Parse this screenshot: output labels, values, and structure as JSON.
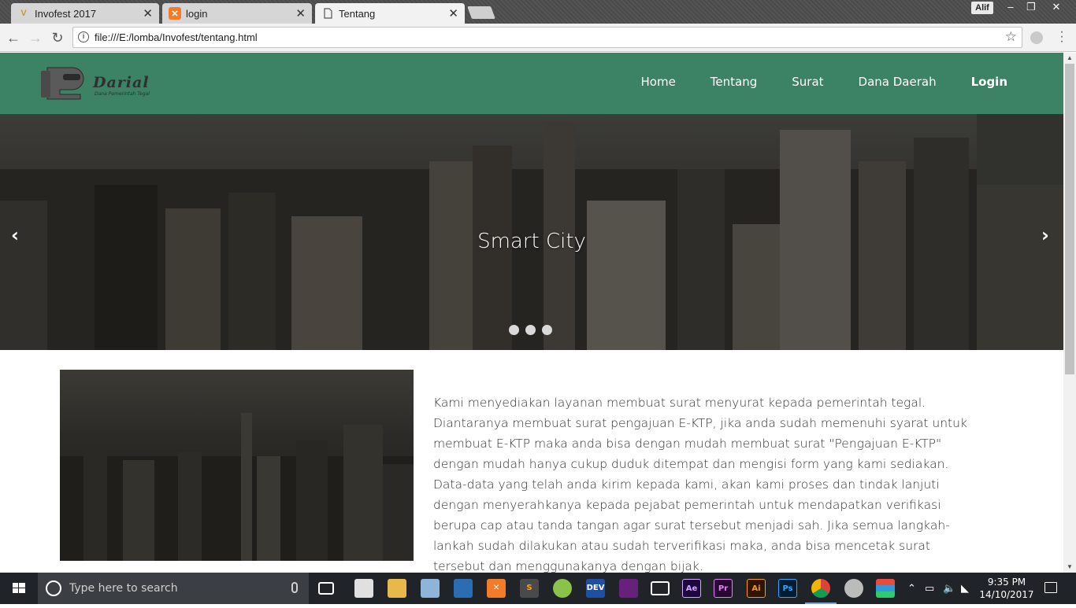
{
  "browser": {
    "tabs": [
      {
        "title": "Invofest 2017",
        "favicon": "v-logo-icon",
        "active": false
      },
      {
        "title": "login",
        "favicon": "xampp-icon",
        "active": false
      },
      {
        "title": "Tentang",
        "favicon": "page-icon",
        "active": true
      }
    ],
    "profile_name": "Alif",
    "url": "file:///E:/lomba/Invofest/tentang.html"
  },
  "site": {
    "logo_text": "Darial",
    "logo_tagline": "Dana Pemerintah Tegal",
    "nav": [
      "Home",
      "Tentang",
      "Surat",
      "Dana Daerah",
      "Login"
    ],
    "nav_bold": "Login",
    "hero_title": "Smart City",
    "prev_glyph": "‹",
    "next_glyph": "›",
    "carousel_count": 3,
    "paragraph": "Kami menyediakan layanan membuat surat menyurat kepada pemerintah tegal. Diantaranya membuat surat pengajuan E-KTP, jika anda sudah memenuhi syarat untuk membuat E-KTP maka anda bisa dengan mudah membuat surat \"Pengajuan E-KTP\" dengan mudah hanya cukup duduk ditempat dan mengisi form yang kami sediakan. Data-data yang telah anda kirim kepada kami, akan kami proses dan tindak lanjuti dengan menyerahkanya kepada pejabat pemerintah untuk mendapatkan verifikasi berupa cap atau tanda tangan agar surat tersebut menjadi sah. Jika semua langkah-lankah sudah dilakukan atau sudah terverifikasi maka, anda bisa mencetak surat tersebut dan menggunakanya dengan bijak.",
    "colors": {
      "nav_bg": "#3c8264",
      "text": "#333333"
    }
  },
  "taskbar": {
    "search_placeholder": "Type here to search",
    "time": "9:35 PM",
    "date": "14/10/2017",
    "apps": [
      "task-view-icon",
      "store-icon",
      "file-explorer-icon",
      "box-icon",
      "visual-studio-code-icon",
      "xampp-icon",
      "sublime-text-icon",
      "android-studio-icon",
      "dev-cpp-icon",
      "visual-studio-icon",
      "film-icon",
      "after-effects-icon",
      "premiere-icon",
      "illustrator-icon",
      "photoshop-icon",
      "chrome-icon",
      "drop-icon",
      "color-bars-icon"
    ]
  }
}
